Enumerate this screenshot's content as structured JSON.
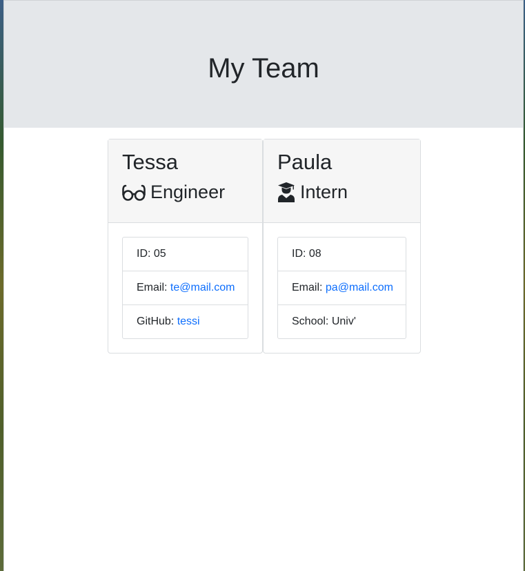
{
  "page": {
    "title": "My Team"
  },
  "colors": {
    "jumbotron_bg": "#e4e7ea",
    "card_header_bg": "#f6f6f6",
    "link": "#0d6efd",
    "text": "#212529"
  },
  "team": [
    {
      "name": "Tessa",
      "role": "Engineer",
      "icon": "glasses-icon",
      "id_label": "ID:",
      "id_value": "05",
      "email_label": "Email:",
      "email_value": "te@mail.com",
      "extra_label": "GitHub:",
      "extra_value": "tessi"
    },
    {
      "name": "Paula",
      "role": "Intern",
      "icon": "graduate-icon",
      "id_label": "ID:",
      "id_value": "08",
      "email_label": "Email:",
      "email_value": "pa@mail.com",
      "extra_label": "School:",
      "extra_value": "Univ'"
    }
  ]
}
